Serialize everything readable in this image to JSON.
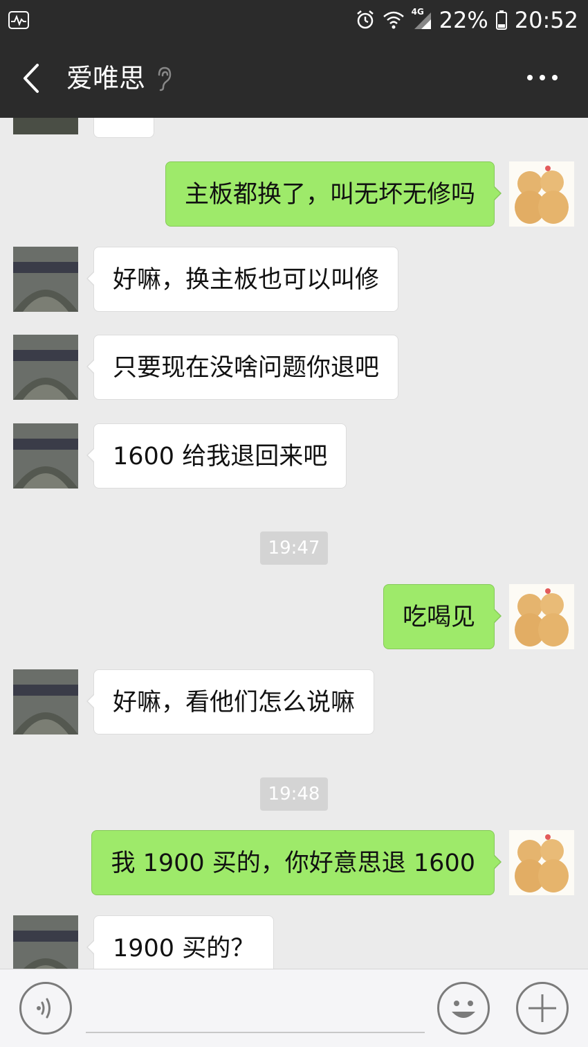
{
  "status_bar": {
    "network": "4G",
    "battery": "22%",
    "time": "20:52"
  },
  "header": {
    "back_icon": "chevron-left-icon",
    "title": "爱唯思",
    "ear_icon": "ear-icon",
    "more_icon": "more-horizontal-icon"
  },
  "messages": [
    {
      "type": "in",
      "text": "主板都换了，叫无坏无修吗"
    },
    {
      "type": "in",
      "text": ""
    },
    {
      "type": "in",
      "text": "好嘛，换主板也可以叫修"
    },
    {
      "type": "in",
      "text": "只要现在没啥问题你退吧"
    },
    {
      "type": "in",
      "text": "1600 给我退回来吧"
    },
    {
      "type": "out",
      "text": "吃喝见"
    },
    {
      "type": "in",
      "text": "好嘛，看他们怎么说嘛"
    },
    {
      "type": "out",
      "text": "我 1900 买的，你好意思退 1600"
    },
    {
      "type": "in",
      "text": "1900 买的？"
    }
  ],
  "chat": {
    "m_out_1": "主板都换了，叫无坏无修吗",
    "m_in_1": "好嘛，换主板也可以叫修",
    "m_in_2": "只要现在没啥问题你退吧",
    "m_in_3": "1600 给我退回来吧",
    "time_1": "19:47",
    "m_out_2": "吃喝见",
    "m_in_4": "好嘛，看他们怎么说嘛",
    "time_2": "19:48",
    "m_out_3": "我 1900 买的，你好意思退 1600",
    "m_in_5": "1900 买的？"
  },
  "input_bar": {
    "voice_icon": "voice-icon",
    "emoji_icon": "emoji-icon",
    "plus_icon": "plus-icon",
    "input_value": ""
  },
  "colors": {
    "header_bg": "#2b2b2b",
    "chat_bg": "#ebebeb",
    "outgoing_bubble": "#9eea6a",
    "incoming_bubble": "#ffffff"
  }
}
